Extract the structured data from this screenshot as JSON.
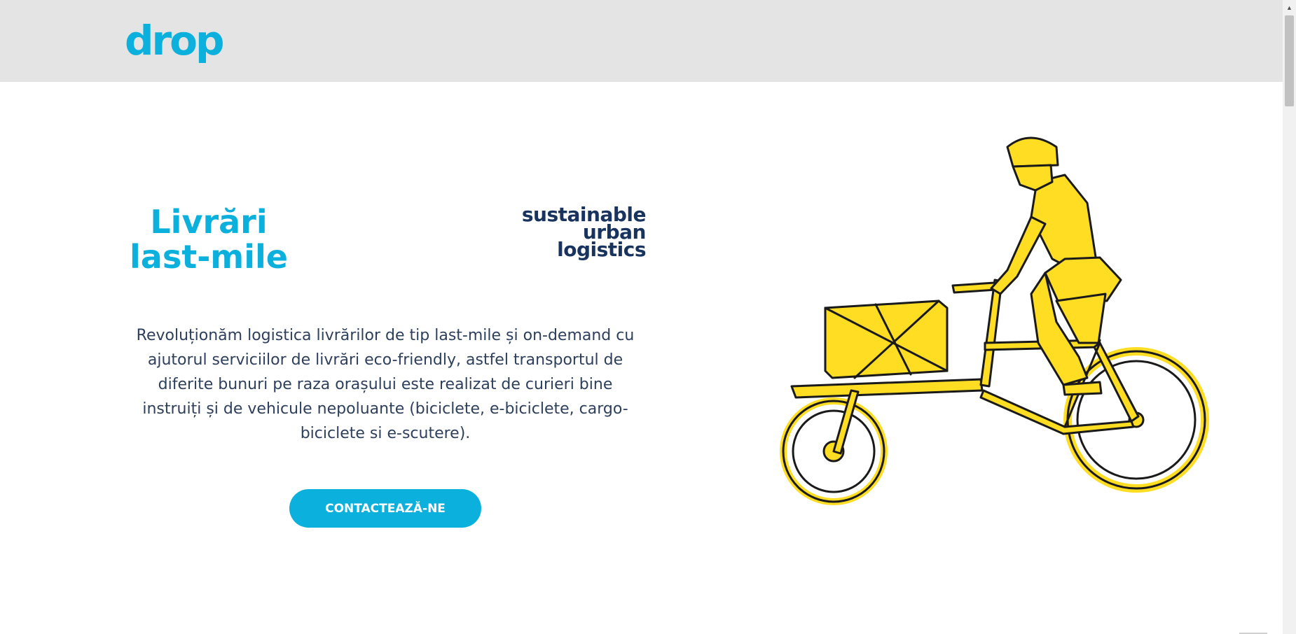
{
  "header": {
    "logo_text": "drop",
    "background_color": "#e4e4e4"
  },
  "hero": {
    "title_line1": "Livrări",
    "title_line2": "last-mile",
    "tagline_line1": "sustainable",
    "tagline_line2": "urban",
    "tagline_line3": "logistics",
    "description": "Revoluționăm logistica livrărilor de tip last-mile și on-demand cu ajutorul serviciilor de livrări eco-friendly, astfel transportul de diferite bunuri pe raza orașului este realizat de curieri bine instruiți și de vehicule nepoluante (biciclete, e-biciclete, cargo-biciclete si e-scutere).",
    "cta_label": "CONTACTEAZĂ-NE",
    "illustration_icon": "cargo-bike-courier-illustration"
  },
  "colors": {
    "accent": "#0bb0dc",
    "navy": "#17335e",
    "illustration_fill": "#ffdd22",
    "text": "#2e3f5c"
  }
}
